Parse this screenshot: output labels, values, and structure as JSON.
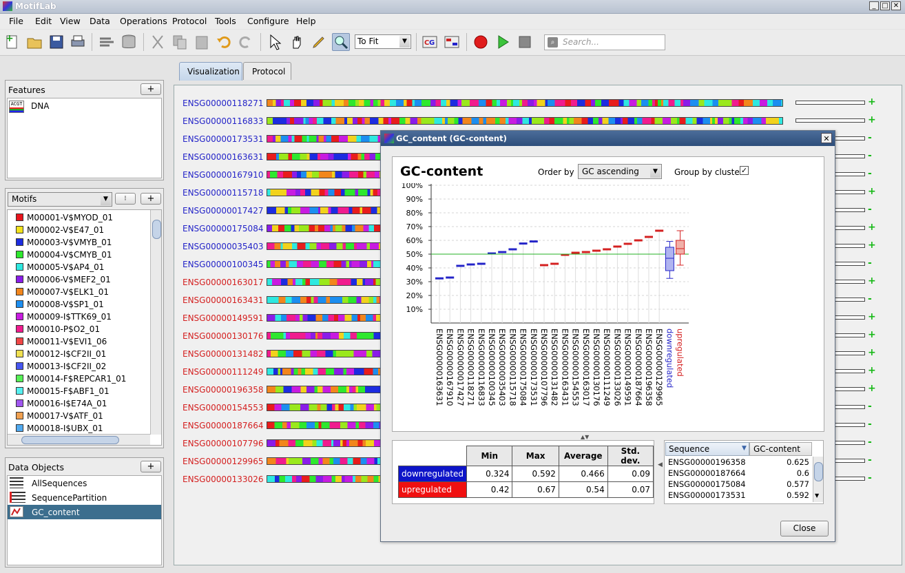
{
  "app": {
    "title": "MotifLab"
  },
  "menu": [
    "File",
    "Edit",
    "View",
    "Data",
    "Operations",
    "Protocol",
    "Tools",
    "Configure",
    "Help"
  ],
  "toolbar": {
    "zoom_select": "To Fit",
    "search_placeholder": "Search..."
  },
  "tabs": {
    "visualization": "Visualization",
    "protocol": "Protocol"
  },
  "features": {
    "title": "Features",
    "add": "+",
    "items": [
      {
        "icon": "ACGT",
        "label": "DNA"
      }
    ]
  },
  "motifs": {
    "select": "Motifs",
    "add": "+",
    "items": [
      {
        "label": "M00001-V$MYOD_01",
        "color": "#e8141c"
      },
      {
        "label": "M00002-V$E47_01",
        "color": "#f2e21c"
      },
      {
        "label": "M00003-V$VMYB_01",
        "color": "#1c2ce0"
      },
      {
        "label": "M00004-V$CMYB_01",
        "color": "#2ee82e"
      },
      {
        "label": "M00005-V$AP4_01",
        "color": "#2ee8e0"
      },
      {
        "label": "M00006-V$MEF2_01",
        "color": "#8a1ce8"
      },
      {
        "label": "M00007-V$ELK1_01",
        "color": "#f2861c"
      },
      {
        "label": "M00008-V$SP1_01",
        "color": "#1c8ef0"
      },
      {
        "label": "M00009-I$TTK69_01",
        "color": "#c81ce0"
      },
      {
        "label": "M00010-P$O2_01",
        "color": "#f01c8e"
      },
      {
        "label": "M00011-V$EVI1_06",
        "color": "#f04646"
      },
      {
        "label": "M00012-I$CF2II_01",
        "color": "#f0e050"
      },
      {
        "label": "M00013-I$CF2II_02",
        "color": "#4656f0"
      },
      {
        "label": "M00014-F$REPCAR1_01",
        "color": "#56f056"
      },
      {
        "label": "M00015-F$ABF1_01",
        "color": "#56f0f0"
      },
      {
        "label": "M00016-I$E74A_01",
        "color": "#a056f0"
      },
      {
        "label": "M00017-V$ATF_01",
        "color": "#f0a050"
      },
      {
        "label": "M00018-I$UBX_01",
        "color": "#50aaf0"
      }
    ]
  },
  "data_objects": {
    "title": "Data Objects",
    "add": "+",
    "items": [
      "AllSequences",
      "SequencePartition",
      "GC_content"
    ]
  },
  "sequences": [
    {
      "name": "ENSG00000118271",
      "group": "down",
      "sign": "+"
    },
    {
      "name": "ENSG00000116833",
      "group": "down",
      "sign": "+"
    },
    {
      "name": "ENSG00000173531",
      "group": "down",
      "sign": "-"
    },
    {
      "name": "ENSG00000163631",
      "group": "down",
      "sign": "-"
    },
    {
      "name": "ENSG00000167910",
      "group": "down",
      "sign": "-"
    },
    {
      "name": "ENSG00000115718",
      "group": "down",
      "sign": "+"
    },
    {
      "name": "ENSG00000017427",
      "group": "down",
      "sign": "-"
    },
    {
      "name": "ENSG00000175084",
      "group": "down",
      "sign": "+"
    },
    {
      "name": "ENSG00000035403",
      "group": "down",
      "sign": "+"
    },
    {
      "name": "ENSG00000100345",
      "group": "down",
      "sign": "-"
    },
    {
      "name": "ENSG00000163017",
      "group": "up",
      "sign": "+"
    },
    {
      "name": "ENSG00000163431",
      "group": "up",
      "sign": "-"
    },
    {
      "name": "ENSG00000149591",
      "group": "up",
      "sign": "+"
    },
    {
      "name": "ENSG00000130176",
      "group": "up",
      "sign": "+"
    },
    {
      "name": "ENSG00000131482",
      "group": "up",
      "sign": "+"
    },
    {
      "name": "ENSG00000111249",
      "group": "up",
      "sign": "+"
    },
    {
      "name": "ENSG00000196358",
      "group": "up",
      "sign": "+"
    },
    {
      "name": "ENSG00000154553",
      "group": "up",
      "sign": "-"
    },
    {
      "name": "ENSG00000187664",
      "group": "up",
      "sign": "-"
    },
    {
      "name": "ENSG00000107796",
      "group": "up",
      "sign": "-"
    },
    {
      "name": "ENSG00000129965",
      "group": "up",
      "sign": "-"
    },
    {
      "name": "ENSG00000133026",
      "group": "up",
      "sign": "-"
    }
  ],
  "colors": {
    "down": "#2424c8",
    "up": "#d42020",
    "plus": "#14b814"
  },
  "dialog": {
    "title": "GC_content  (GC-content)",
    "heading": "GC-content",
    "order_label": "Order by",
    "order_value": "GC ascending",
    "group_label": "Group by cluster",
    "close": "Close",
    "stats": {
      "headers": [
        "Min",
        "Max",
        "Average",
        "Std. dev."
      ],
      "rows": [
        {
          "name": "downregulated",
          "min": "0.324",
          "max": "0.592",
          "avg": "0.466",
          "sd": "0.09"
        },
        {
          "name": "upregulated",
          "min": "0.42",
          "max": "0.67",
          "avg": "0.54",
          "sd": "0.07"
        }
      ]
    },
    "value_table": {
      "headers": [
        "Sequence",
        "GC-content"
      ],
      "rows": [
        {
          "seq": "ENSG00000196358",
          "val": "0.625"
        },
        {
          "seq": "ENSG00000187664",
          "val": "0.6"
        },
        {
          "seq": "ENSG00000175084",
          "val": "0.577"
        },
        {
          "seq": "ENSG00000173531",
          "val": "0.592"
        }
      ]
    }
  },
  "chart_data": {
    "type": "bar",
    "ylim": [
      0,
      1
    ],
    "yticks": [
      "10%",
      "20%",
      "30%",
      "40%",
      "50%",
      "60%",
      "70%",
      "80%",
      "90%",
      "100%"
    ],
    "reference_line": 0.5,
    "series": [
      {
        "name": "downregulated",
        "color": "#2424c8",
        "categories": [
          "ENSG00000163631",
          "ENSG00000167910",
          "ENSG00000017427",
          "ENSG00000118271",
          "ENSG00000116833",
          "ENSG00000100345",
          "ENSG00000035403",
          "ENSG00000115718",
          "ENSG00000175084",
          "ENSG00000173531"
        ],
        "values": [
          0.324,
          0.33,
          0.415,
          0.425,
          0.43,
          0.505,
          0.515,
          0.535,
          0.577,
          0.592
        ]
      },
      {
        "name": "upregulated",
        "color": "#d42020",
        "categories": [
          "ENSG00000107796",
          "ENSG00000131482",
          "ENSG00000163431",
          "ENSG00000154553",
          "ENSG00000163017",
          "ENSG00000130176",
          "ENSG00000111249",
          "ENSG00000133026",
          "ENSG00000149591",
          "ENSG00000187664",
          "ENSG00000196358",
          "ENSG00000129965"
        ],
        "values": [
          0.42,
          0.43,
          0.495,
          0.51,
          0.515,
          0.525,
          0.535,
          0.555,
          0.575,
          0.6,
          0.625,
          0.67
        ]
      }
    ],
    "boxplots": [
      {
        "name": "downregulated",
        "min": 0.324,
        "q1": 0.38,
        "median": 0.47,
        "q3": 0.55,
        "max": 0.592
      },
      {
        "name": "upregulated",
        "min": 0.42,
        "q1": 0.5,
        "median": 0.54,
        "q3": 0.6,
        "max": 0.67
      }
    ]
  }
}
